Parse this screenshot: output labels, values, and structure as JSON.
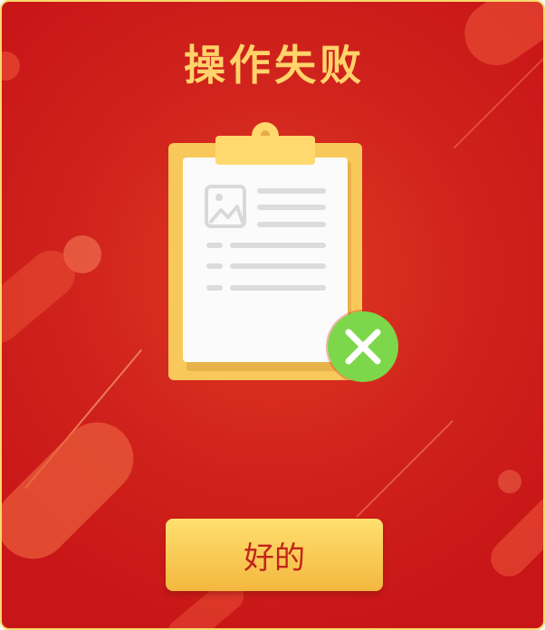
{
  "dialog": {
    "title": "操作失败",
    "confirm_label": "好的"
  },
  "icons": {
    "illustration": "clipboard-document-icon",
    "status": "close-icon"
  },
  "colors": {
    "background": "#d0231c",
    "border": "#f8d96a",
    "title": "#ffd36a",
    "button_top": "#ffe070",
    "button_bottom": "#f3b73e",
    "button_text": "#c3231b",
    "error_badge": "#7dd74a"
  }
}
